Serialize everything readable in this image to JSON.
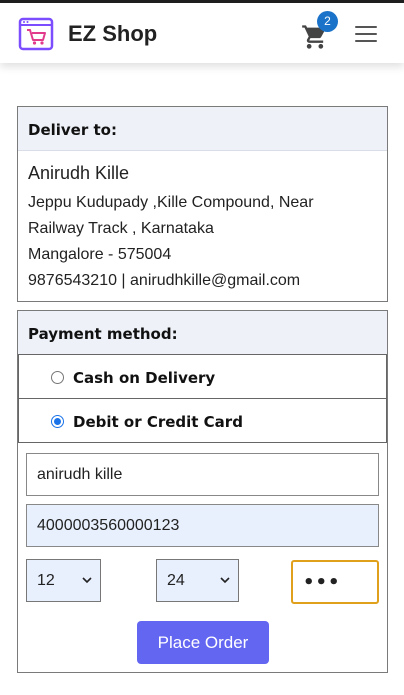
{
  "header": {
    "brand": "EZ Shop",
    "cart_count": "2",
    "icons": [
      "shop-logo-icon",
      "cart-icon",
      "hamburger-menu-icon"
    ],
    "accent_color": "#6366f1",
    "badge_color": "#1a73c9"
  },
  "delivery": {
    "heading": "Deliver to:",
    "name": "Anirudh Kille",
    "address_line1": "Jeppu Kudupady ,Kille Compound, Near",
    "address_line2": "Railway Track , Karnataka",
    "city_pin": "Mangalore - 575004",
    "contact": "9876543210 | anirudhkille@gmail.com"
  },
  "payment": {
    "heading": "Payment method:",
    "options": [
      {
        "label": "Cash on Delivery",
        "selected": false
      },
      {
        "label": "Debit or Credit Card",
        "selected": true
      }
    ],
    "card_name": "anirudh kille",
    "card_number": "4000003560000123",
    "expiry_month": "12",
    "expiry_year": "24",
    "cvv_masked": "•••",
    "place_order_label": "Place Order"
  }
}
